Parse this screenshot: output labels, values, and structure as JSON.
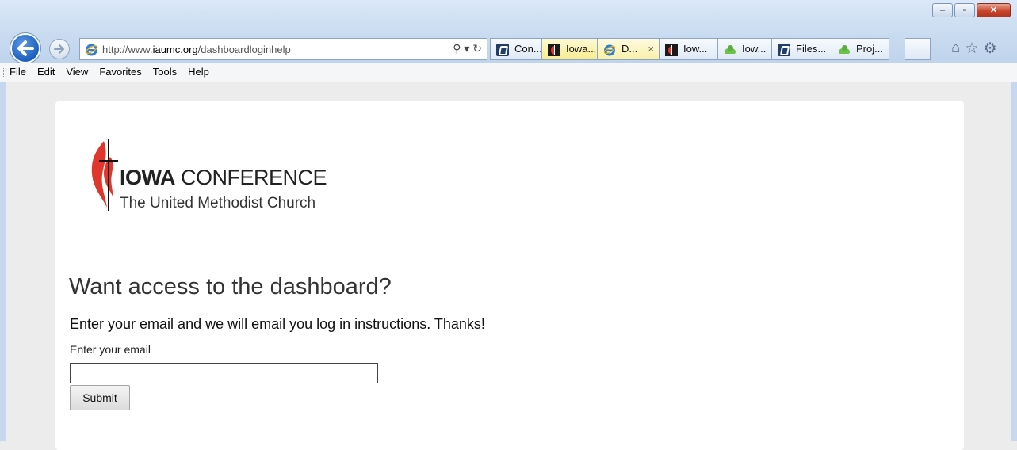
{
  "browser": {
    "address": {
      "url_prefix": "http://www.",
      "url_domain": "iaumc.org",
      "url_path": "/dashboardloginhelp",
      "search_glyph": "⚲ ▾",
      "refresh_glyph": "↻"
    },
    "tabs": [
      {
        "label": "Con...",
        "icon": "kq-icon",
        "state": "normal"
      },
      {
        "label": "Iowa...",
        "icon": "umc-icon",
        "state": "yellow"
      },
      {
        "label": "D...",
        "icon": "ie-icon",
        "state": "active",
        "close": "×"
      },
      {
        "label": "Iow...",
        "icon": "umc-icon",
        "state": "normal"
      },
      {
        "label": "Iow...",
        "icon": "cloud-icon",
        "state": "normal"
      },
      {
        "label": "Files...",
        "icon": "kq-icon",
        "state": "normal"
      },
      {
        "label": "Proj...",
        "icon": "cloud-icon",
        "state": "normal"
      }
    ],
    "window_buttons": {
      "minimize": "–",
      "maximize": "▫",
      "close": "✕"
    },
    "right_icons": {
      "home": "⌂",
      "favorites": "☆",
      "tools": "⚙"
    },
    "menu": [
      "File",
      "Edit",
      "View",
      "Favorites",
      "Tools",
      "Help"
    ]
  },
  "page": {
    "logo": {
      "org_bold": "IOWA",
      "org_rest": " CONFERENCE",
      "subtitle": "The United Methodist Church"
    },
    "heading": "Want access to the dashboard?",
    "lead": "Enter your email and we will email you log in instructions. Thanks!",
    "email_label": "Enter your email",
    "email_value": "",
    "submit_label": "Submit"
  }
}
